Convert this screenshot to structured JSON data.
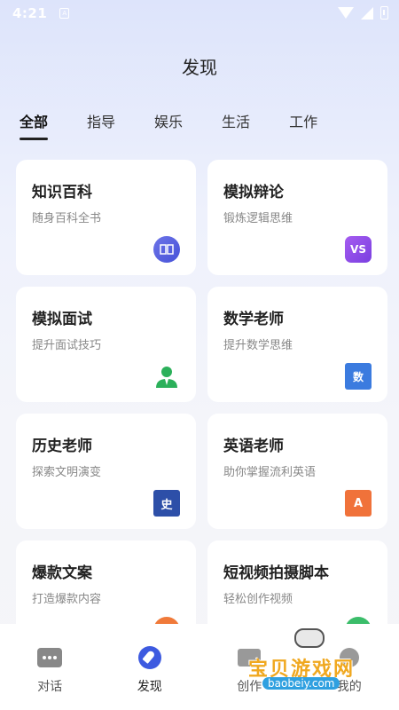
{
  "status_bar": {
    "time": "4:21",
    "notif_icon": "A"
  },
  "header": {
    "title": "发现"
  },
  "tabs": [
    {
      "label": "全部",
      "active": true
    },
    {
      "label": "指导",
      "active": false
    },
    {
      "label": "娱乐",
      "active": false
    },
    {
      "label": "生活",
      "active": false
    },
    {
      "label": "工作",
      "active": false
    }
  ],
  "cards": [
    {
      "title": "知识百科",
      "subtitle": "随身百科全书",
      "icon": "book-icon"
    },
    {
      "title": "模拟辩论",
      "subtitle": "锻炼逻辑思维",
      "icon": "vs-icon",
      "icon_text": "VS"
    },
    {
      "title": "模拟面试",
      "subtitle": "提升面试技巧",
      "icon": "person-icon"
    },
    {
      "title": "数学老师",
      "subtitle": "提升数学思维",
      "icon": "math-folder-icon",
      "icon_text": "数"
    },
    {
      "title": "历史老师",
      "subtitle": "探索文明演变",
      "icon": "history-book-icon",
      "icon_text": "史"
    },
    {
      "title": "英语老师",
      "subtitle": "助你掌握流利英语",
      "icon": "english-notebook-icon",
      "icon_text": "A"
    },
    {
      "title": "爆款文案",
      "subtitle": "打造爆款内容",
      "icon": "orange-icon"
    },
    {
      "title": "短视频拍摄脚本",
      "subtitle": "轻松创作视频",
      "icon": "green-icon"
    }
  ],
  "bottom_nav": [
    {
      "label": "对话",
      "icon": "chat-icon",
      "active": false
    },
    {
      "label": "发现",
      "icon": "compass-icon",
      "active": true
    },
    {
      "label": "创作",
      "icon": "create-icon",
      "active": false
    },
    {
      "label": "我的",
      "icon": "profile-icon",
      "active": false
    }
  ],
  "watermark": {
    "text": "宝贝游戏网",
    "url": "baobeiy.com"
  },
  "colors": {
    "accent": "#3d5ae0",
    "background_top": "#dde4fb",
    "card": "#ffffff"
  }
}
